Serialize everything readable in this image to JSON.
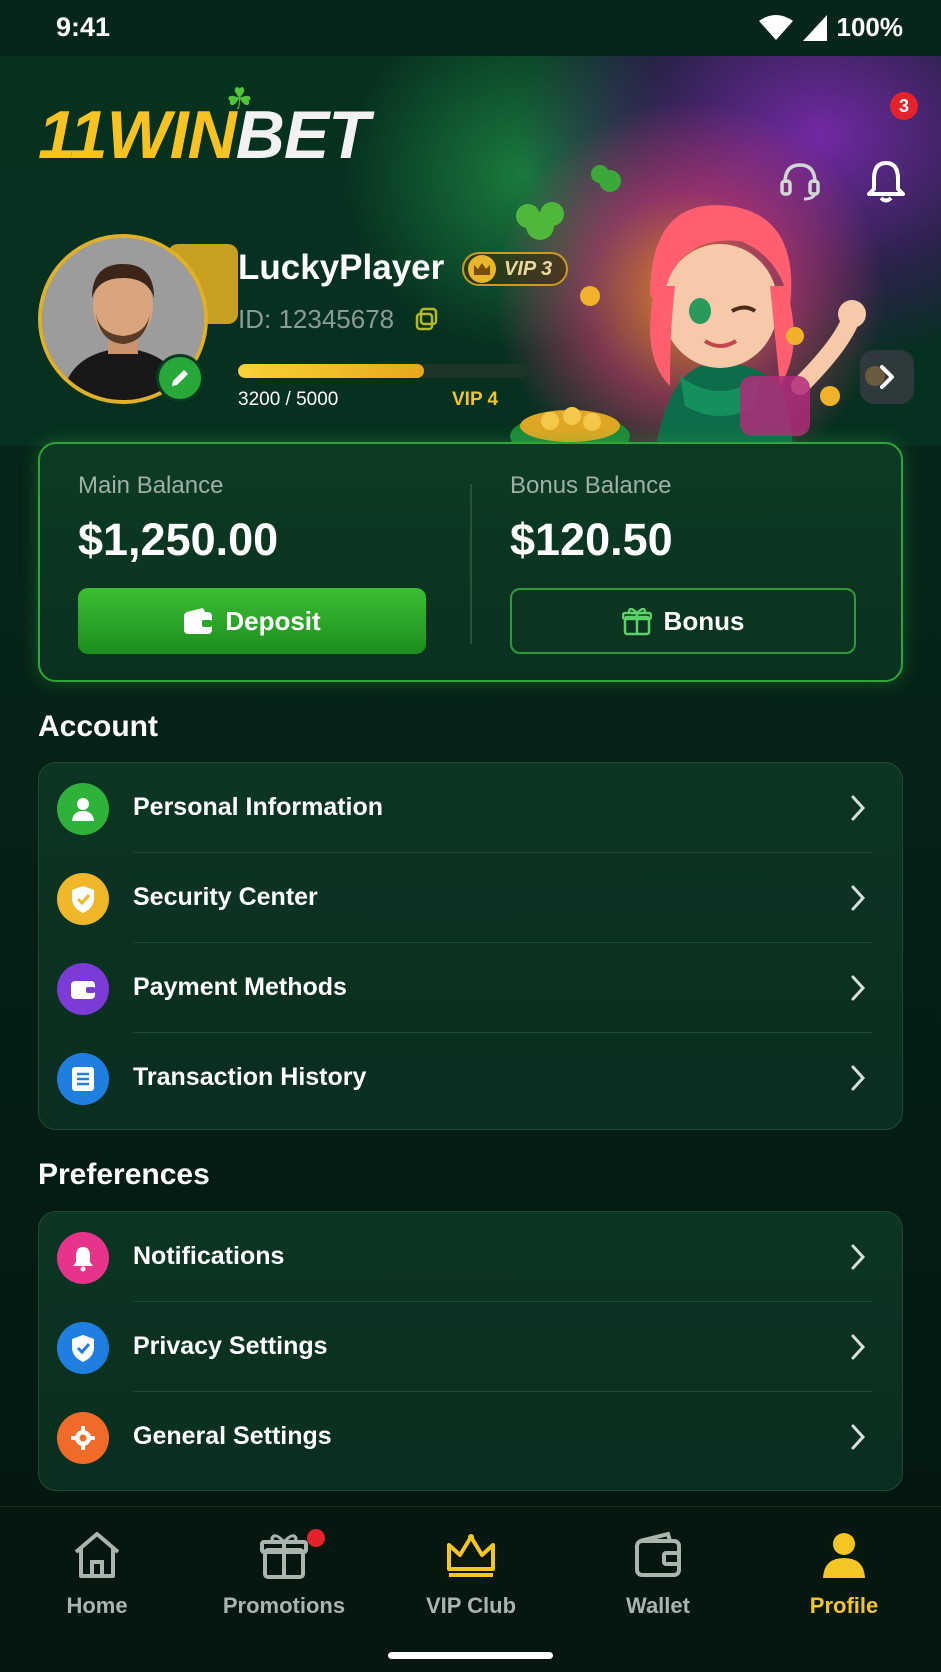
{
  "status_bar": {
    "time": "9:41",
    "battery": "100%"
  },
  "header": {
    "logo_part1": "11WIN",
    "logo_part2": "BET",
    "notification_count": "3"
  },
  "profile": {
    "username": "LuckyPlayer",
    "vip_label": "VIP 3",
    "user_id": "ID: 12345678",
    "progress_text": "3200 / 5000",
    "progress_fraction": 0.64,
    "next_level": "VIP 4"
  },
  "balances": {
    "main_label": "Main Balance",
    "main_value": "$1,250.00",
    "deposit_label": "Deposit",
    "bonus_label": "Bonus Balance",
    "bonus_value": "$120.50",
    "bonus_button_label": "Bonus"
  },
  "account": {
    "title": "Account",
    "items": [
      {
        "label": "Personal Information",
        "icon": "user-icon",
        "color": "#2fb23a"
      },
      {
        "label": "Security Center",
        "icon": "shield-icon",
        "color": "#f0b72a"
      },
      {
        "label": "Payment Methods",
        "icon": "wallet-icon",
        "color": "#7c3ad6"
      },
      {
        "label": "Transaction History",
        "icon": "list-icon",
        "color": "#1f7fe0"
      }
    ]
  },
  "preferences": {
    "title": "Preferences",
    "items": [
      {
        "label": "Notifications",
        "icon": "bell-icon",
        "color": "#e8338a"
      },
      {
        "label": "Privacy Settings",
        "icon": "privacy-shield-icon",
        "color": "#1f7fe0"
      },
      {
        "label": "General Settings",
        "icon": "gear-icon",
        "color": "#f06a28"
      }
    ]
  },
  "nav": {
    "items": [
      {
        "label": "Home",
        "icon": "home-icon"
      },
      {
        "label": "Promotions",
        "icon": "gift-icon"
      },
      {
        "label": "VIP Club",
        "icon": "crown-icon"
      },
      {
        "label": "Wallet",
        "icon": "wallet-icon"
      },
      {
        "label": "Profile",
        "icon": "profile-icon"
      }
    ],
    "active": "Profile"
  },
  "colors": {
    "accent_gold": "#f5c523",
    "accent_green": "#2fa43a",
    "background": "#062318"
  }
}
